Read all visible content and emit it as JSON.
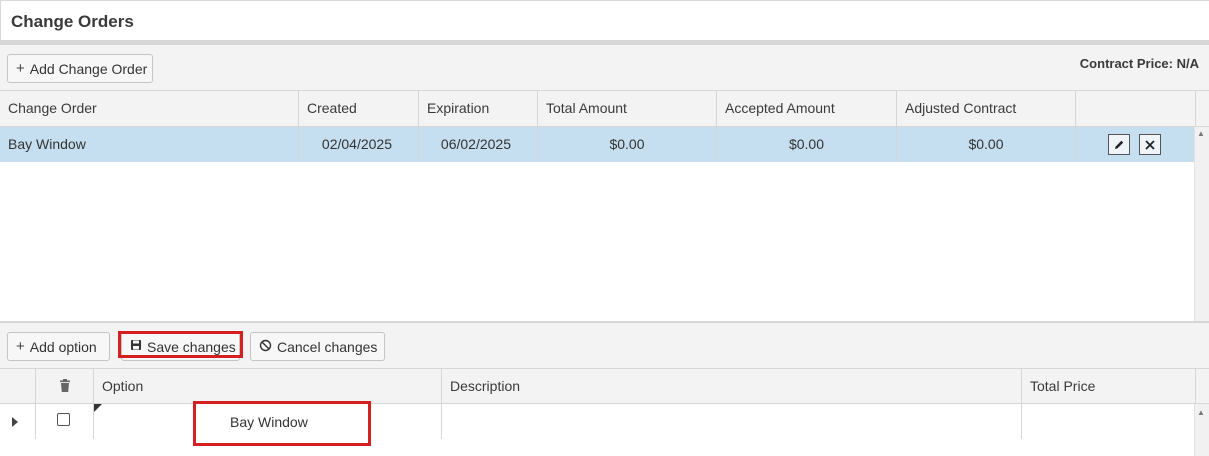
{
  "page": {
    "title": "Change Orders"
  },
  "toolbar": {
    "add_change_order_label": "Add Change Order",
    "contract_price_label": "Contract Price: N/A"
  },
  "change_orders": {
    "columns": [
      "Change Order",
      "Created",
      "Expiration",
      "Total Amount",
      "Accepted Amount",
      "Adjusted Contract"
    ],
    "rows": [
      {
        "name": "Bay Window",
        "created": "02/04/2025",
        "expiration": "06/02/2025",
        "total_amount": "$0.00",
        "accepted_amount": "$0.00",
        "adjusted_contract": "$0.00",
        "selected": true
      }
    ]
  },
  "options_toolbar": {
    "add_option_label": "Add option",
    "save_changes_label": "Save changes",
    "cancel_changes_label": "Cancel changes"
  },
  "options": {
    "columns": [
      "Option",
      "Description",
      "Total Price"
    ],
    "rows": [
      {
        "option": "Bay Window",
        "description": "",
        "total_price": "",
        "checked": false
      }
    ]
  },
  "colors": {
    "selected_row": "#c5dff0",
    "highlight_box": "#d42020",
    "header_bg": "#f3f3f3"
  },
  "icons": [
    "plus-icon",
    "save-icon",
    "cancel-circle-icon",
    "trash-icon",
    "edit-pencil-icon",
    "delete-x-icon",
    "expand-arrow-icon",
    "scroll-up-icon"
  ]
}
